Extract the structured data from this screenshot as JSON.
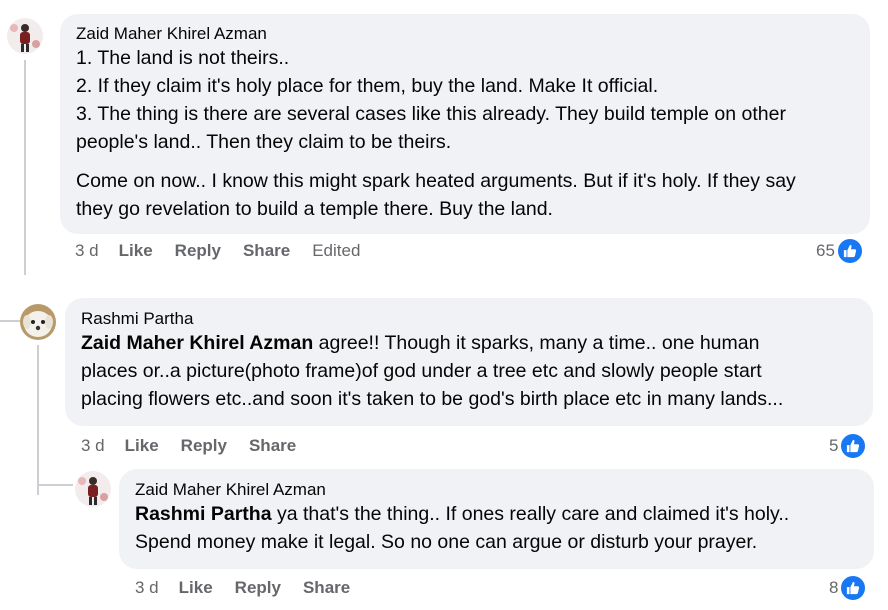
{
  "comments": [
    {
      "author": "Zaid Maher Khirel Azman",
      "lines": [
        "1. The land is not theirs..",
        "2. If they claim it's holy place for them, buy the land. Make It official.",
        "3. The thing is there are several cases like this already. They build temple on other",
        "people's land.. Then they claim to be theirs."
      ],
      "lines2": [
        "Come on now.. I know this might spark heated arguments. But if it's holy. If they say",
        "they go revelation to build a temple there. Buy the land."
      ],
      "time": "3 d",
      "like_label": "Like",
      "reply_label": "Reply",
      "share_label": "Share",
      "edited_label": "Edited",
      "reactions": "65"
    },
    {
      "author": "Rashmi Partha",
      "mention": "Zaid Maher Khirel Azman",
      "first_line_rest": " agree!! Though it sparks, many a time.. one human",
      "lines": [
        "places or..a picture(photo frame)of god under a tree etc and slowly people start",
        "placing flowers etc..and soon it's taken to be god's birth place etc in many lands..."
      ],
      "time": "3 d",
      "like_label": "Like",
      "reply_label": "Reply",
      "share_label": "Share",
      "reactions": "5"
    },
    {
      "author": "Zaid Maher Khirel Azman",
      "mention": "Rashmi Partha",
      "first_line_rest": " ya that's the thing.. If ones really care and claimed it's holy..",
      "lines": [
        "Spend money make it legal. So no one can argue or disturb your prayer."
      ],
      "time": "3 d",
      "like_label": "Like",
      "reply_label": "Reply",
      "share_label": "Share",
      "reactions": "8"
    }
  ],
  "colors": {
    "bubble": "#f0f2f5",
    "meta_text": "#65676b",
    "like_blue": "#1877f2",
    "thread_line": "#ccd0d5"
  },
  "icons": {
    "reaction": "thumbs-up-icon"
  }
}
